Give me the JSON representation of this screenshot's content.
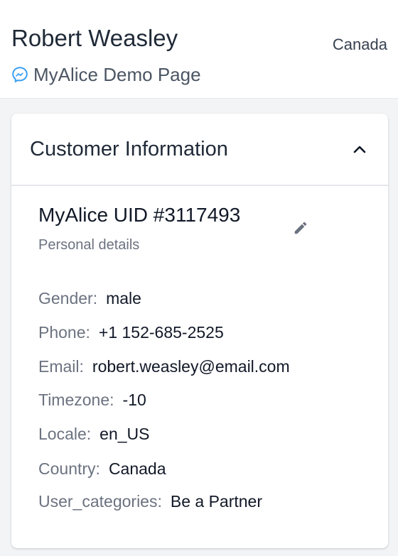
{
  "header": {
    "customer_name": "Robert Weasley",
    "country": "Canada",
    "channel_icon": "messenger-icon",
    "channel_name": "MyAlice Demo Page"
  },
  "card": {
    "title": "Customer Information",
    "collapse_icon": "chevron-up-icon",
    "uid": "MyAlice UID #3117493",
    "subtitle": "Personal details",
    "edit_icon": "pencil-icon",
    "fields": [
      {
        "label": "Gender:",
        "value": "male"
      },
      {
        "label": "Phone:",
        "value": "+1 152-685-2525"
      },
      {
        "label": "Email:",
        "value": "robert.weasley@email.com"
      },
      {
        "label": "Timezone:",
        "value": "-10"
      },
      {
        "label": "Locale:",
        "value": "en_US"
      },
      {
        "label": "Country:",
        "value": "Canada"
      },
      {
        "label": "User_categories:",
        "value": "Be a Partner"
      }
    ]
  },
  "colors": {
    "messenger_blue": "#3b9ff3",
    "label_gray": "#6b7280",
    "text_dark": "#111827",
    "background": "#f3f4f6"
  }
}
